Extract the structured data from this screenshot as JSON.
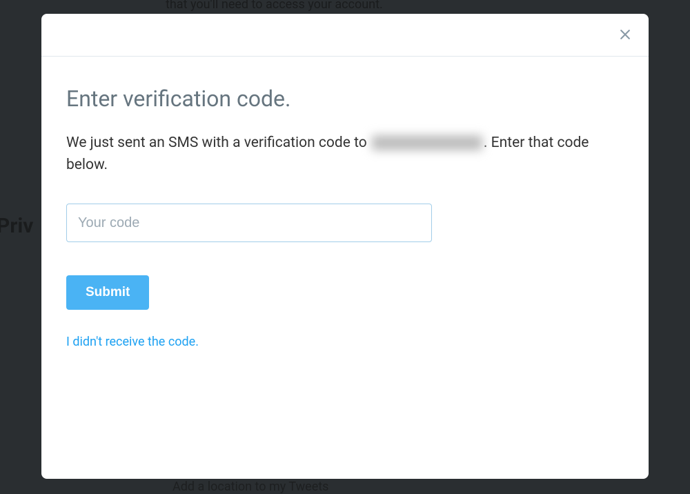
{
  "modal": {
    "title": "Enter verification code.",
    "description_part1": "We just sent an SMS with a verification code to ",
    "description_part2": ". Enter that code below.",
    "code_placeholder": "Your code",
    "submit_label": "Submit",
    "resend_link": "I didn't receive the code."
  },
  "background": {
    "top_text": "that you'll need to access your account.",
    "left_text": "Priv",
    "bottom_text": "Add a location to my Tweets"
  }
}
